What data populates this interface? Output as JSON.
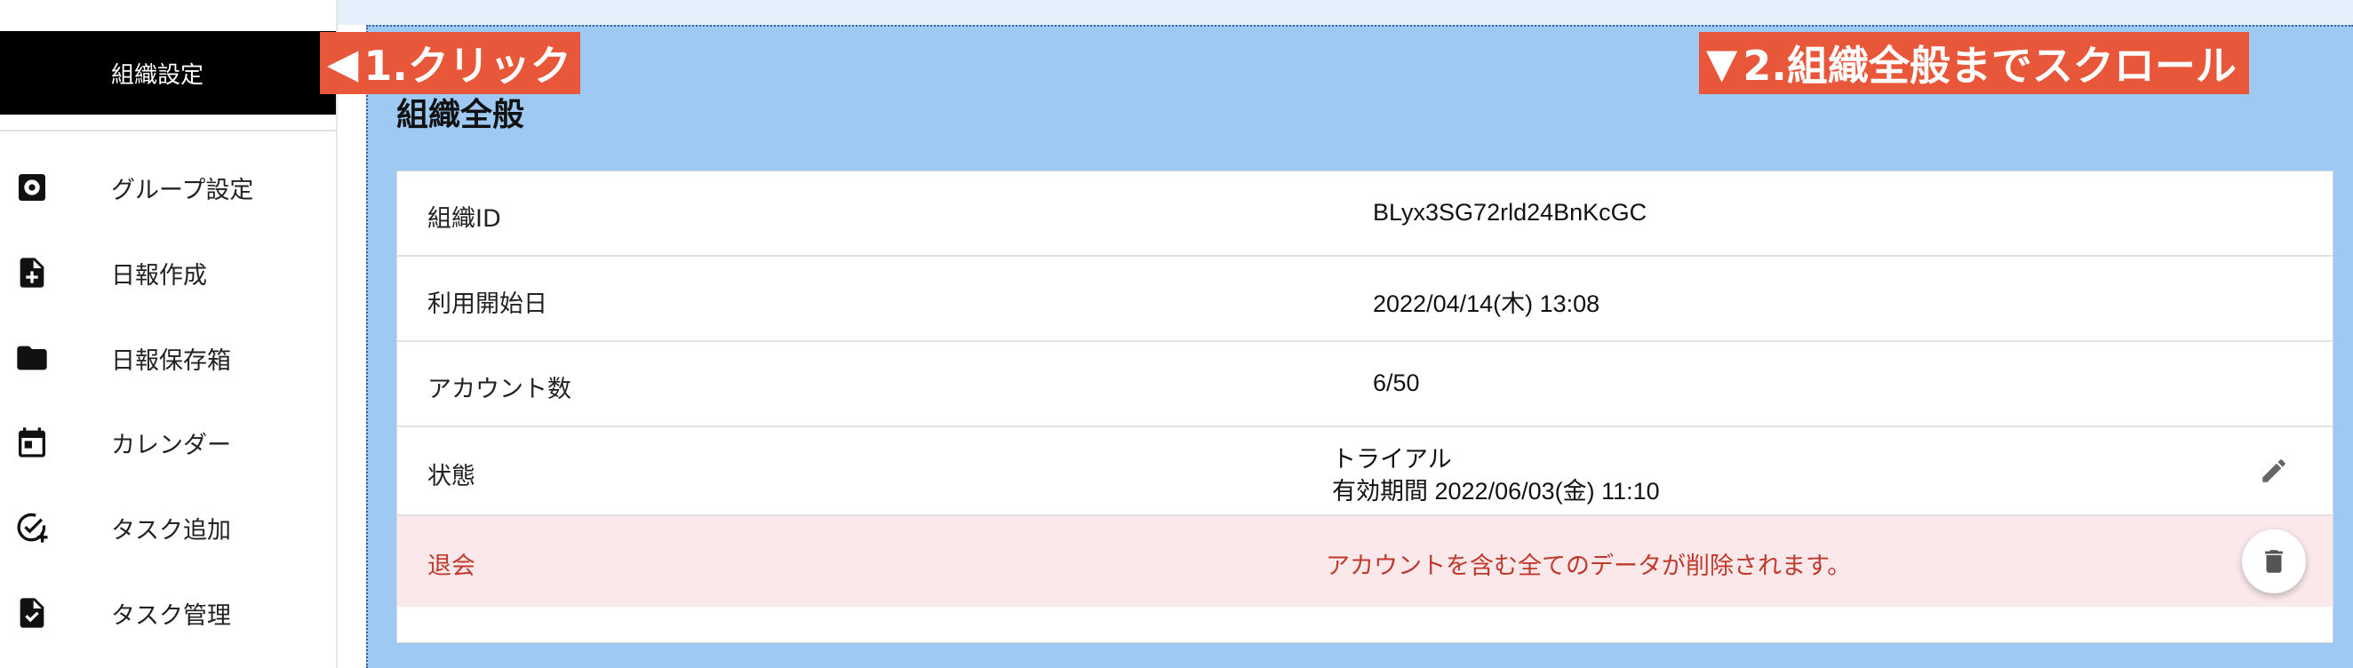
{
  "sidebar": {
    "active_item": "組織設定",
    "items": [
      {
        "label": "グループ設定",
        "icon": "gear-icon"
      },
      {
        "label": "日報作成",
        "icon": "file-plus-icon"
      },
      {
        "label": "日報保存箱",
        "icon": "folder-icon"
      },
      {
        "label": "カレンダー",
        "icon": "calendar-icon"
      },
      {
        "label": "タスク追加",
        "icon": "task-add-icon"
      },
      {
        "label": "タスク管理",
        "icon": "clipboard-check-icon"
      }
    ]
  },
  "annotations": {
    "step1": "1.クリック",
    "step1_arrow": "◀",
    "step2": "2.組織全般までスクロール",
    "step2_arrow": "▼"
  },
  "section": {
    "title": "組織全般",
    "rows": [
      {
        "key": "組織ID",
        "value": "BLyx3SG72rld24BnKcGC"
      },
      {
        "key": "利用開始日",
        "value": "2022/04/14(木) 13:08"
      },
      {
        "key": "アカウント数",
        "value": "6/50"
      },
      {
        "key": "状態",
        "value_line1": "トライアル",
        "value_line2": "有効期間 2022/06/03(金) 11:10"
      },
      {
        "key": "退会",
        "value": "アカウントを含む全てのデータが削除されます。"
      }
    ]
  },
  "colors": {
    "highlight": "#9dc9f3",
    "callout": "#e8573a",
    "danger_bg": "#fae8ea",
    "danger_text": "#c0392b"
  }
}
